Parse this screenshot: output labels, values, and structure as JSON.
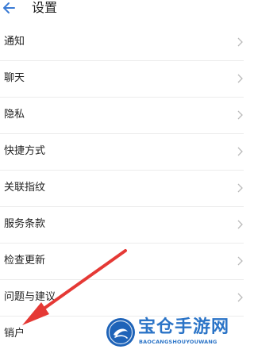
{
  "header": {
    "title": "设置",
    "back_icon": "back-arrow-icon"
  },
  "settings": {
    "items": [
      {
        "label": "通知"
      },
      {
        "label": "聊天"
      },
      {
        "label": "隐私"
      },
      {
        "label": "快捷方式"
      },
      {
        "label": "关联指纹"
      },
      {
        "label": "服务条款"
      },
      {
        "label": "检查更新"
      },
      {
        "label": "问题与建议"
      },
      {
        "label": "销户"
      }
    ],
    "chevron_icon": "chevron-right-icon"
  },
  "annotation": {
    "arrow_color": "#e53935",
    "arrow_icon": "red-arrow-annotation"
  },
  "watermark": {
    "title": "宝仓手游网",
    "subtitle": "BAOCANGSHOUYOUWANG",
    "color": "#2b74c7"
  }
}
